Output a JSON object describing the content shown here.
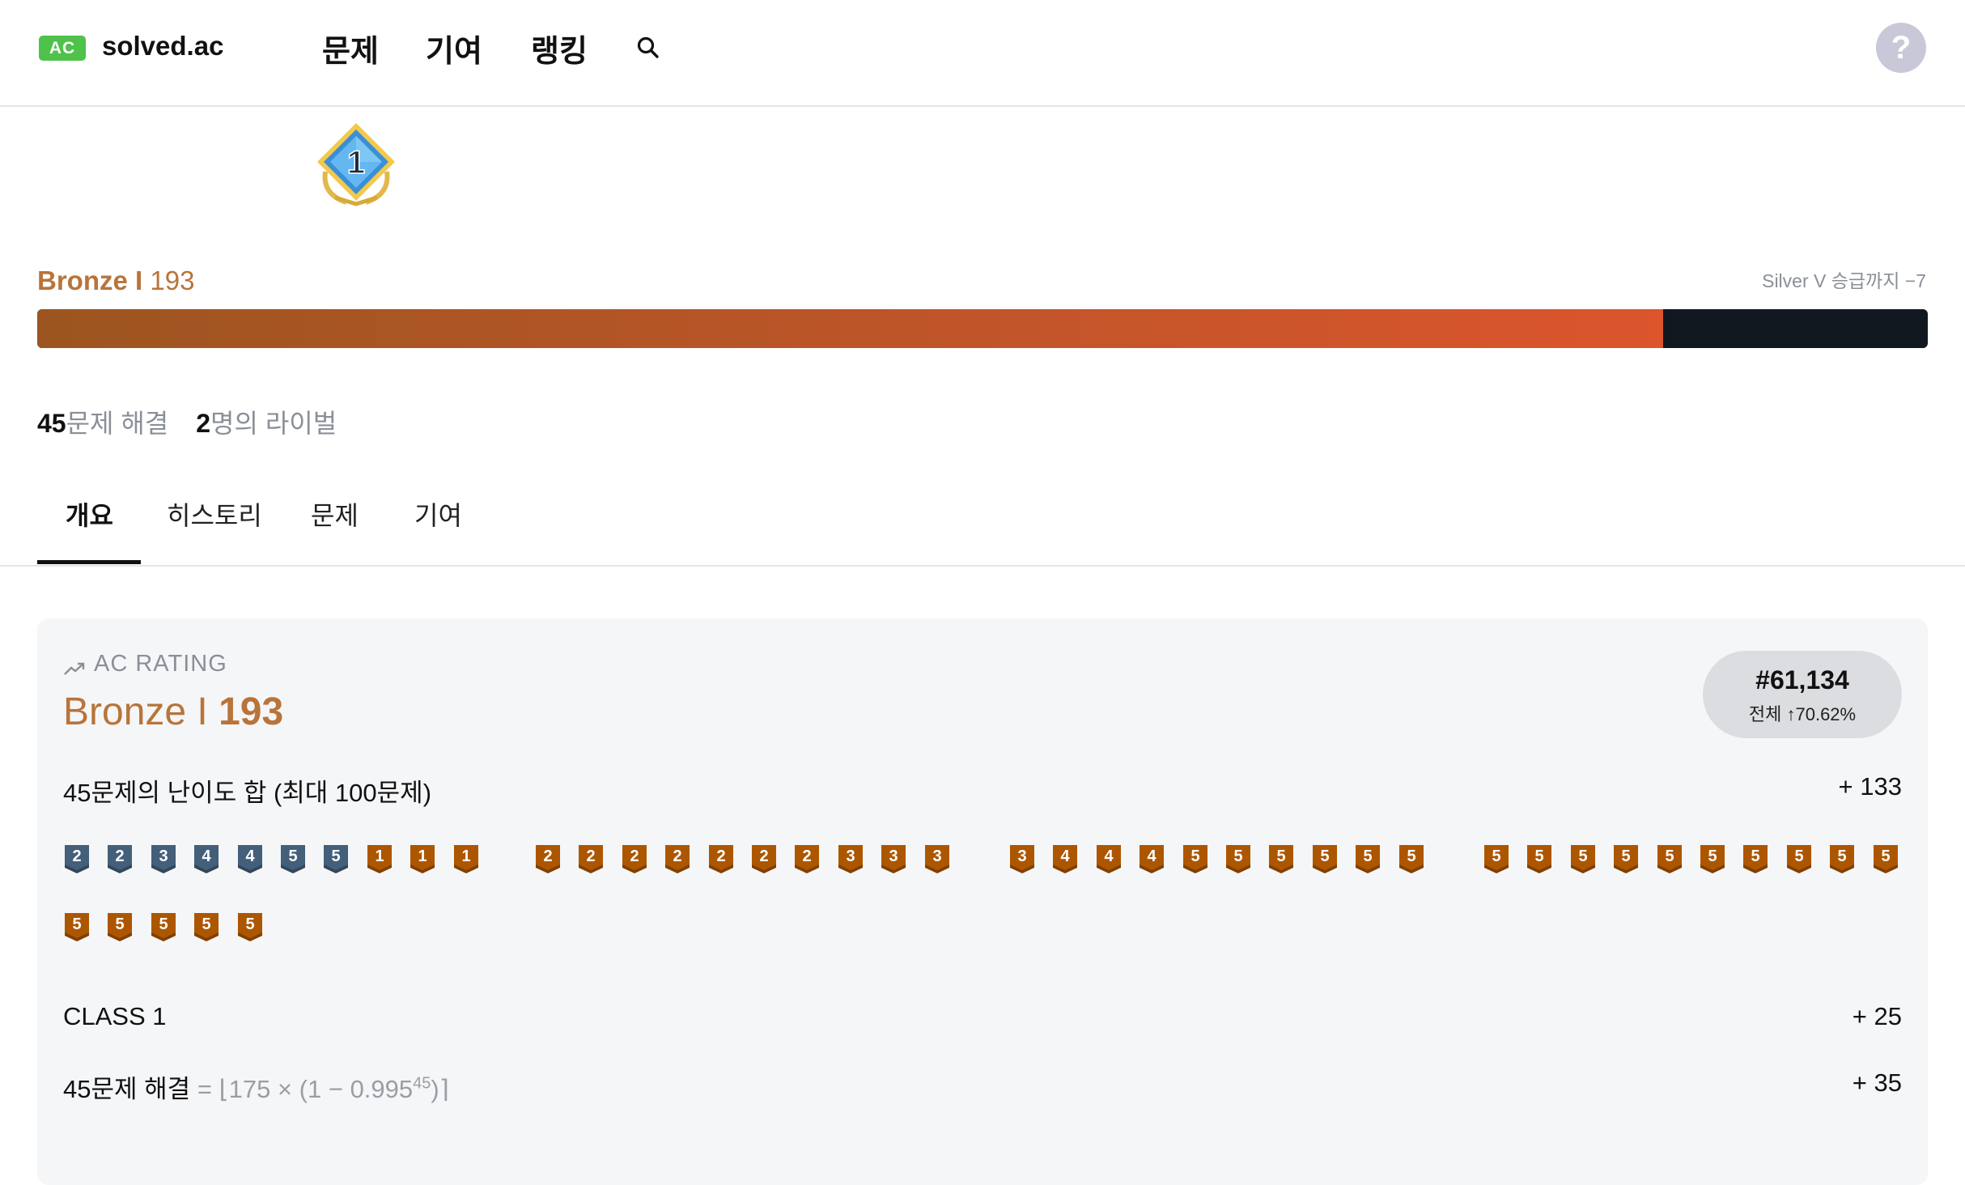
{
  "header": {
    "logo_badge": "AC",
    "logo_text": "solved.ac",
    "nav": [
      "문제",
      "기여",
      "랭킹"
    ],
    "help_label": "?"
  },
  "tier_badge": {
    "label": "1",
    "tier": "Bronze I"
  },
  "rating": {
    "tier": "Bronze I",
    "value": "193",
    "promotion": "Silver V 승급까지 −7",
    "progress_fraction": 0.86
  },
  "stats": {
    "solved_count": "45",
    "solved_label": "문제 해결",
    "rivals_count": "2",
    "rivals_label": "명의 라이벌"
  },
  "tabs": [
    "개요",
    "히스토리",
    "문제",
    "기여"
  ],
  "card": {
    "heading": "AC RATING",
    "tier": "Bronze I",
    "value": "193",
    "rank": "#61,134",
    "rank_sub": "전체 ↑70.62%",
    "difficulty_label": "45문제의 난이도 합 (최대 100문제)",
    "difficulty_value": "+ 133",
    "class_label": "CLASS 1",
    "class_value": "+ 25",
    "solved_label": "45문제 해결",
    "solved_formula_prefix": "= ⌊175 × (1 − 0.995",
    "solved_formula_exp": "45",
    "solved_formula_suffix": ")⌉",
    "solved_value": "+ 35"
  },
  "problem_chips": [
    {
      "n": "2",
      "tier": "silver"
    },
    {
      "n": "2",
      "tier": "silver"
    },
    {
      "n": "3",
      "tier": "silver"
    },
    {
      "n": "4",
      "tier": "silver"
    },
    {
      "n": "4",
      "tier": "silver"
    },
    {
      "n": "5",
      "tier": "silver"
    },
    {
      "n": "5",
      "tier": "silver"
    },
    {
      "n": "1",
      "tier": "bronze"
    },
    {
      "n": "1",
      "tier": "bronze"
    },
    {
      "n": "1",
      "tier": "bronze"
    },
    {
      "n": "2",
      "tier": "bronze"
    },
    {
      "n": "2",
      "tier": "bronze"
    },
    {
      "n": "2",
      "tier": "bronze"
    },
    {
      "n": "2",
      "tier": "bronze"
    },
    {
      "n": "2",
      "tier": "bronze"
    },
    {
      "n": "2",
      "tier": "bronze"
    },
    {
      "n": "2",
      "tier": "bronze"
    },
    {
      "n": "3",
      "tier": "bronze"
    },
    {
      "n": "3",
      "tier": "bronze"
    },
    {
      "n": "3",
      "tier": "bronze"
    },
    {
      "n": "3",
      "tier": "bronze"
    },
    {
      "n": "4",
      "tier": "bronze"
    },
    {
      "n": "4",
      "tier": "bronze"
    },
    {
      "n": "4",
      "tier": "bronze"
    },
    {
      "n": "5",
      "tier": "bronze"
    },
    {
      "n": "5",
      "tier": "bronze"
    },
    {
      "n": "5",
      "tier": "bronze"
    },
    {
      "n": "5",
      "tier": "bronze"
    },
    {
      "n": "5",
      "tier": "bronze"
    },
    {
      "n": "5",
      "tier": "bronze"
    },
    {
      "n": "5",
      "tier": "bronze"
    },
    {
      "n": "5",
      "tier": "bronze"
    },
    {
      "n": "5",
      "tier": "bronze"
    },
    {
      "n": "5",
      "tier": "bronze"
    },
    {
      "n": "5",
      "tier": "bronze"
    },
    {
      "n": "5",
      "tier": "bronze"
    },
    {
      "n": "5",
      "tier": "bronze"
    },
    {
      "n": "5",
      "tier": "bronze"
    },
    {
      "n": "5",
      "tier": "bronze"
    },
    {
      "n": "5",
      "tier": "bronze"
    },
    {
      "n": "5",
      "tier": "bronze"
    },
    {
      "n": "5",
      "tier": "bronze"
    },
    {
      "n": "5",
      "tier": "bronze"
    },
    {
      "n": "5",
      "tier": "bronze"
    },
    {
      "n": "5",
      "tier": "bronze"
    }
  ],
  "colors": {
    "bronze": "#b8743a",
    "bronze_chip": "#ad5600",
    "silver_chip": "#435f7a",
    "logo_green": "#4ec24a",
    "bar_track": "#111820"
  }
}
